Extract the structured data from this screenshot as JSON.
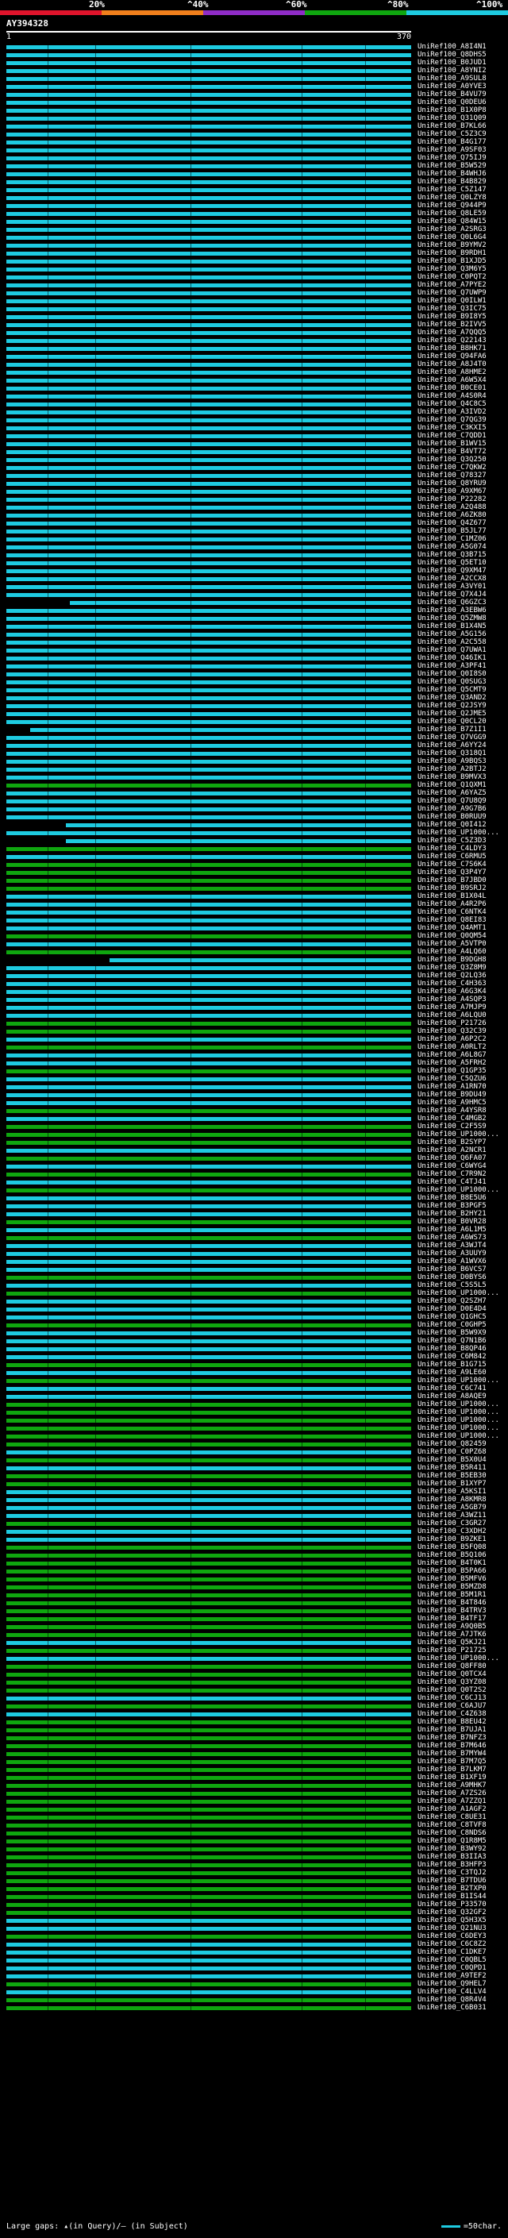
{
  "scale": {
    "labels": [
      "20%",
      "^40%",
      "^60%",
      "^80%",
      "^100%"
    ],
    "colors": [
      "#e0142c",
      "#f07f1c",
      "#8f2cc7",
      "#0fa60f",
      "#1ecbe1"
    ]
  },
  "query": {
    "id": "AY394328",
    "start": "1",
    "end": "370"
  },
  "hits": [
    {
      "label": "UniRef100_A8I4N1",
      "c": "#1ecbe1"
    },
    {
      "label": "UniRef100_Q8DHS5",
      "c": "#1ecbe1"
    },
    {
      "label": "UniRef100_B0JUD1",
      "c": "#1ecbe1"
    },
    {
      "label": "UniRef100_A8YNI2",
      "c": "#1ecbe1"
    },
    {
      "label": "UniRef100_A9SUL8",
      "c": "#1ecbe1"
    },
    {
      "label": "UniRef100_A0YVE3",
      "c": "#1ecbe1"
    },
    {
      "label": "UniRef100_B4VU79",
      "c": "#1ecbe1"
    },
    {
      "label": "UniRef100_Q0DEU6",
      "c": "#1ecbe1"
    },
    {
      "label": "UniRef100_B1X0P8",
      "c": "#1ecbe1"
    },
    {
      "label": "UniRef100_Q31Q09",
      "c": "#1ecbe1"
    },
    {
      "label": "UniRef100_B7KL66",
      "c": "#1ecbe1"
    },
    {
      "label": "UniRef100_C5Z3C9",
      "c": "#1ecbe1"
    },
    {
      "label": "UniRef100_B4G177",
      "c": "#1ecbe1"
    },
    {
      "label": "UniRef100_A9SF03",
      "c": "#1ecbe1"
    },
    {
      "label": "UniRef100_Q75IJ9",
      "c": "#1ecbe1"
    },
    {
      "label": "UniRef100_B5W529",
      "c": "#1ecbe1"
    },
    {
      "label": "UniRef100_B4WHJ6",
      "c": "#1ecbe1"
    },
    {
      "label": "UniRef100_B4B829",
      "c": "#1ecbe1"
    },
    {
      "label": "UniRef100_C5Z147",
      "c": "#1ecbe1"
    },
    {
      "label": "UniRef100_Q0LZY8",
      "c": "#1ecbe1"
    },
    {
      "label": "UniRef100_Q944P9",
      "c": "#1ecbe1"
    },
    {
      "label": "UniRef100_Q8LE59",
      "c": "#1ecbe1"
    },
    {
      "label": "UniRef100_Q84W15",
      "c": "#1ecbe1"
    },
    {
      "label": "UniRef100_A2SRG3",
      "c": "#1ecbe1"
    },
    {
      "label": "UniRef100_Q0L6G4",
      "c": "#1ecbe1"
    },
    {
      "label": "UniRef100_B9YMV2",
      "c": "#1ecbe1"
    },
    {
      "label": "UniRef100_B9RDH1",
      "c": "#1ecbe1"
    },
    {
      "label": "UniRef100_B1XJD5",
      "c": "#1ecbe1"
    },
    {
      "label": "UniRef100_Q3M6Y5",
      "c": "#1ecbe1"
    },
    {
      "label": "UniRef100_C0PQT2",
      "c": "#1ecbe1"
    },
    {
      "label": "UniRef100_A7PYE2",
      "c": "#1ecbe1"
    },
    {
      "label": "UniRef100_Q7UWP9",
      "c": "#1ecbe1"
    },
    {
      "label": "UniRef100_Q0ILW1",
      "c": "#1ecbe1"
    },
    {
      "label": "UniRef100_Q3IC75",
      "c": "#1ecbe1"
    },
    {
      "label": "UniRef100_B9I8Y5",
      "c": "#1ecbe1"
    },
    {
      "label": "UniRef100_B2IVV5",
      "c": "#1ecbe1"
    },
    {
      "label": "UniRef100_A7QQQ5",
      "c": "#1ecbe1"
    },
    {
      "label": "UniRef100_Q22143",
      "c": "#1ecbe1"
    },
    {
      "label": "UniRef100_B8HK71",
      "c": "#1ecbe1"
    },
    {
      "label": "UniRef100_Q94FA6",
      "c": "#1ecbe1"
    },
    {
      "label": "UniRef100_A8J4T0",
      "c": "#1ecbe1"
    },
    {
      "label": "UniRef100_A8HME2",
      "c": "#1ecbe1"
    },
    {
      "label": "UniRef100_A6W5X4",
      "c": "#1ecbe1"
    },
    {
      "label": "UniRef100_B0CE01",
      "c": "#1ecbe1"
    },
    {
      "label": "UniRef100_A4S0R4",
      "c": "#1ecbe1"
    },
    {
      "label": "UniRef100_Q4C8C5",
      "c": "#1ecbe1"
    },
    {
      "label": "UniRef100_A3IVD2",
      "c": "#1ecbe1"
    },
    {
      "label": "UniRef100_Q7QG39",
      "c": "#1ecbe1"
    },
    {
      "label": "UniRef100_C3KXI5",
      "c": "#1ecbe1"
    },
    {
      "label": "UniRef100_C7QDD1",
      "c": "#1ecbe1"
    },
    {
      "label": "UniRef100_B1WV15",
      "c": "#1ecbe1"
    },
    {
      "label": "UniRef100_B4VT72",
      "c": "#1ecbe1"
    },
    {
      "label": "UniRef100_Q3Q250",
      "c": "#1ecbe1"
    },
    {
      "label": "UniRef100_C7QKW2",
      "c": "#1ecbe1"
    },
    {
      "label": "UniRef100_Q78327",
      "c": "#1ecbe1"
    },
    {
      "label": "UniRef100_Q8YRU9",
      "c": "#1ecbe1"
    },
    {
      "label": "UniRef100_A9XM67",
      "c": "#1ecbe1"
    },
    {
      "label": "UniRef100_P22282",
      "c": "#1ecbe1"
    },
    {
      "label": "UniRef100_A2Q488",
      "c": "#1ecbe1"
    },
    {
      "label": "UniRef100_A6ZK80",
      "c": "#1ecbe1"
    },
    {
      "label": "UniRef100_Q4Z677",
      "c": "#1ecbe1"
    },
    {
      "label": "UniRef100_B5JL77",
      "c": "#1ecbe1"
    },
    {
      "label": "UniRef100_C1MZ06",
      "c": "#1ecbe1"
    },
    {
      "label": "UniRef100_A5G074",
      "c": "#1ecbe1"
    },
    {
      "label": "UniRef100_Q3B715",
      "c": "#1ecbe1"
    },
    {
      "label": "UniRef100_Q5ET10",
      "c": "#1ecbe1"
    },
    {
      "label": "UniRef100_Q9XM47",
      "c": "#1ecbe1"
    },
    {
      "label": "UniRef100_A2CCX8",
      "c": "#1ecbe1"
    },
    {
      "label": "UniRef100_A3VY01",
      "c": "#1ecbe1"
    },
    {
      "label": "UniRef100_Q7X4J4",
      "c": "#1ecbe1"
    },
    {
      "label": "UniRef100_Q6GZC3",
      "c": "#1ecbe1",
      "gapL": 0,
      "gapW": 0,
      "blackEnd": 80
    },
    {
      "label": "UniRef100_A3EBW6",
      "c": "#1ecbe1"
    },
    {
      "label": "UniRef100_Q5ZMW8",
      "c": "#1ecbe1"
    },
    {
      "label": "UniRef100_B1X4N5",
      "c": "#1ecbe1"
    },
    {
      "label": "UniRef100_A5G156",
      "c": "#1ecbe1"
    },
    {
      "label": "UniRef100_A2C558",
      "c": "#1ecbe1"
    },
    {
      "label": "UniRef100_Q7UWA1",
      "c": "#1ecbe1"
    },
    {
      "label": "UniRef100_Q46IK1",
      "c": "#1ecbe1"
    },
    {
      "label": "UniRef100_A3PF41",
      "c": "#1ecbe1"
    },
    {
      "label": "UniRef100_Q0I8S0",
      "c": "#1ecbe1"
    },
    {
      "label": "UniRef100_Q0SUG3",
      "c": "#1ecbe1"
    },
    {
      "label": "UniRef100_Q5CMT9",
      "c": "#1ecbe1"
    },
    {
      "label": "UniRef100_Q3AND2",
      "c": "#1ecbe1"
    },
    {
      "label": "UniRef100_Q2JSY9",
      "c": "#1ecbe1"
    },
    {
      "label": "UniRef100_Q2JME5",
      "c": "#1ecbe1"
    },
    {
      "label": "UniRef100_Q0CL20",
      "c": "#1ecbe1"
    },
    {
      "label": "UniRef100_B7Z1I1",
      "c": "#1ecbe1",
      "blackEnd": 30
    },
    {
      "label": "UniRef100_Q7VGG9",
      "c": "#1ecbe1"
    },
    {
      "label": "UniRef100_A6YY24",
      "c": "#1ecbe1"
    },
    {
      "label": "UniRef100_Q318Q1",
      "c": "#1ecbe1"
    },
    {
      "label": "UniRef100_A9BQS3",
      "c": "#1ecbe1"
    },
    {
      "label": "UniRef100_A2BTJ2",
      "c": "#1ecbe1"
    },
    {
      "label": "UniRef100_B9MVX3",
      "c": "#1ecbe1"
    },
    {
      "label": "UniRef100_Q1QXM1",
      "c": "#0fa60f"
    },
    {
      "label": "UniRef100_A6YAZ5",
      "c": "#1ecbe1"
    },
    {
      "label": "UniRef100_Q7U8Q9",
      "c": "#1ecbe1"
    },
    {
      "label": "UniRef100_A9G7B6",
      "c": "#1ecbe1"
    },
    {
      "label": "UniRef100_B0RUU9",
      "c": "#1ecbe1"
    },
    {
      "label": "UniRef100_Q0I412",
      "c": "#1ecbe1",
      "blackEnd": 75
    },
    {
      "label": "UniRef100_UP1000...",
      "c": "#1ecbe1"
    },
    {
      "label": "UniRef100_C5Z3D3",
      "c": "#1ecbe1",
      "blackEnd": 75
    },
    {
      "label": "UniRef100_C4LDY3",
      "c": "#0fa60f"
    },
    {
      "label": "UniRef100_C6RMU5",
      "c": "#1ecbe1"
    },
    {
      "label": "UniRef100_C7S6K4",
      "c": "#0fa60f"
    },
    {
      "label": "UniRef100_Q3P4Y7",
      "c": "#0fa60f"
    },
    {
      "label": "UniRef100_B7JBD0",
      "c": "#0fa60f"
    },
    {
      "label": "UniRef100_B9SRJ2",
      "c": "#0fa60f"
    },
    {
      "label": "UniRef100_B1X04L",
      "c": "#1ecbe1"
    },
    {
      "label": "UniRef100_A4R2P6",
      "c": "#1ecbe1"
    },
    {
      "label": "UniRef100_C6NTK4",
      "c": "#1ecbe1"
    },
    {
      "label": "UniRef100_Q8EI83",
      "c": "#1ecbe1"
    },
    {
      "label": "UniRef100_Q4AMT1",
      "c": "#1ecbe1"
    },
    {
      "label": "UniRef100_Q0QM54",
      "c": "#0fa60f"
    },
    {
      "label": "UniRef100_A5VTP0",
      "c": "#1ecbe1"
    },
    {
      "label": "UniRef100_A4LQ60",
      "c": "#0fa60f"
    },
    {
      "label": "UniRef100_B9DGH8",
      "c": "#1ecbe1",
      "blackEnd": 130
    },
    {
      "label": "UniRef100_Q3Z8M9",
      "c": "#1ecbe1"
    },
    {
      "label": "UniRef100_Q2LQ36",
      "c": "#1ecbe1"
    },
    {
      "label": "UniRef100_C4H363",
      "c": "#1ecbe1"
    },
    {
      "label": "UniRef100_A6G3K4",
      "c": "#1ecbe1"
    },
    {
      "label": "UniRef100_A4SQP3",
      "c": "#1ecbe1"
    },
    {
      "label": "UniRef100_A7MJP9",
      "c": "#1ecbe1"
    },
    {
      "label": "UniRef100_A6LQU0",
      "c": "#1ecbe1"
    },
    {
      "label": "UniRef100_P21726",
      "c": "#0fa60f"
    },
    {
      "label": "UniRef100_Q32C39",
      "c": "#0fa60f"
    },
    {
      "label": "UniRef100_A6P2C2",
      "c": "#1ecbe1"
    },
    {
      "label": "UniRef100_A0RLT2",
      "c": "#0fa60f"
    },
    {
      "label": "UniRef100_A6L8G7",
      "c": "#1ecbe1"
    },
    {
      "label": "UniRef100_A5FRH2",
      "c": "#1ecbe1"
    },
    {
      "label": "UniRef100_Q1GP35",
      "c": "#0fa60f"
    },
    {
      "label": "UniRef100_C5QZU6",
      "c": "#1ecbe1"
    },
    {
      "label": "UniRef100_A1RN70",
      "c": "#1ecbe1"
    },
    {
      "label": "UniRef100_B9DU49",
      "c": "#1ecbe1"
    },
    {
      "label": "UniRef100_A9HMC5",
      "c": "#1ecbe1"
    },
    {
      "label": "UniRef100_A4YSR8",
      "c": "#0fa60f"
    },
    {
      "label": "UniRef100_C4MGB2",
      "c": "#1ecbe1"
    },
    {
      "label": "UniRef100_C2F5S9",
      "c": "#0fa60f"
    },
    {
      "label": "UniRef100_UP1000...",
      "c": "#0fa60f"
    },
    {
      "label": "UniRef100_B2SYP7",
      "c": "#0fa60f"
    },
    {
      "label": "UniRef100_A2NCR1",
      "c": "#1ecbe1"
    },
    {
      "label": "UniRef100_Q6FA07",
      "c": "#0fa60f"
    },
    {
      "label": "UniRef100_C6WYG4",
      "c": "#1ecbe1"
    },
    {
      "label": "UniRef100_C7R9N2",
      "c": "#0fa60f"
    },
    {
      "label": "UniRef100_C4TJ41",
      "c": "#1ecbe1"
    },
    {
      "label": "UniRef100_UP1000...",
      "c": "#0fa60f"
    },
    {
      "label": "UniRef100_B8E5U6",
      "c": "#1ecbe1"
    },
    {
      "label": "UniRef100_B3PGF5",
      "c": "#1ecbe1"
    },
    {
      "label": "UniRef100_B2HY21",
      "c": "#1ecbe1"
    },
    {
      "label": "UniRef100_B0VR28",
      "c": "#0fa60f"
    },
    {
      "label": "UniRef100_A6L1M5",
      "c": "#1ecbe1"
    },
    {
      "label": "UniRef100_A6WS73",
      "c": "#0fa60f"
    },
    {
      "label": "UniRef100_A3WJT4",
      "c": "#1ecbe1"
    },
    {
      "label": "UniRef100_A3UUY9",
      "c": "#1ecbe1"
    },
    {
      "label": "UniRef100_A1WVX6",
      "c": "#1ecbe1"
    },
    {
      "label": "UniRef100_B6VCS7",
      "c": "#1ecbe1"
    },
    {
      "label": "UniRef100_D0BYS6",
      "c": "#0fa60f"
    },
    {
      "label": "UniRef100_C5S5L5",
      "c": "#1ecbe1"
    },
    {
      "label": "UniRef100_UP1000...",
      "c": "#0fa60f"
    },
    {
      "label": "UniRef100_Q2SZH7",
      "c": "#1ecbe1"
    },
    {
      "label": "UniRef100_D0E4D4",
      "c": "#1ecbe1"
    },
    {
      "label": "UniRef100_Q1GHC5",
      "c": "#1ecbe1"
    },
    {
      "label": "UniRef100_C0GHP5",
      "c": "#0fa60f"
    },
    {
      "label": "UniRef100_B5W9X9",
      "c": "#1ecbe1"
    },
    {
      "label": "UniRef100_Q7N1B6",
      "c": "#1ecbe1"
    },
    {
      "label": "UniRef100_B8QP46",
      "c": "#1ecbe1"
    },
    {
      "label": "UniRef100_C6M842",
      "c": "#1ecbe1"
    },
    {
      "label": "UniRef100_B1G715",
      "c": "#0fa60f"
    },
    {
      "label": "UniRef100_A9LE60",
      "c": "#1ecbe1"
    },
    {
      "label": "UniRef100_UP1000...",
      "c": "#0fa60f"
    },
    {
      "label": "UniRef100_C6C741",
      "c": "#1ecbe1"
    },
    {
      "label": "UniRef100_A8AQE9",
      "c": "#1ecbe1"
    },
    {
      "label": "UniRef100_UP1000...",
      "c": "#0fa60f"
    },
    {
      "label": "UniRef100_UP1000...",
      "c": "#0fa60f"
    },
    {
      "label": "UniRef100_UP1000...",
      "c": "#0fa60f"
    },
    {
      "label": "UniRef100_UP1000...",
      "c": "#0fa60f"
    },
    {
      "label": "UniRef100_UP1000...",
      "c": "#0fa60f"
    },
    {
      "label": "UniRef100_Q82459",
      "c": "#0fa60f"
    },
    {
      "label": "UniRef100_C0PZ68",
      "c": "#1ecbe1"
    },
    {
      "label": "UniRef100_B5X0U4",
      "c": "#0fa60f"
    },
    {
      "label": "UniRef100_B5R411",
      "c": "#1ecbe1"
    },
    {
      "label": "UniRef100_B5EB30",
      "c": "#0fa60f"
    },
    {
      "label": "UniRef100_B1XYP7",
      "c": "#0fa60f"
    },
    {
      "label": "UniRef100_A5KSI1",
      "c": "#1ecbe1"
    },
    {
      "label": "UniRef100_A8KMR8",
      "c": "#1ecbe1"
    },
    {
      "label": "UniRef100_A5GB79",
      "c": "#1ecbe1"
    },
    {
      "label": "UniRef100_A3WZ11",
      "c": "#1ecbe1"
    },
    {
      "label": "UniRef100_C3GR27",
      "c": "#0fa60f"
    },
    {
      "label": "UniRef100_C3XDH2",
      "c": "#1ecbe1"
    },
    {
      "label": "UniRef100_B9ZKE1",
      "c": "#1ecbe1"
    },
    {
      "label": "UniRef100_B5FQ08",
      "c": "#0fa60f"
    },
    {
      "label": "UniRef100_B5Q106",
      "c": "#0fa60f"
    },
    {
      "label": "UniRef100_B4T0K1",
      "c": "#0fa60f"
    },
    {
      "label": "UniRef100_B5PA66",
      "c": "#0fa60f"
    },
    {
      "label": "UniRef100_B5MFV6",
      "c": "#0fa60f"
    },
    {
      "label": "UniRef100_B5MZD8",
      "c": "#0fa60f"
    },
    {
      "label": "UniRef100_B5M1R1",
      "c": "#0fa60f"
    },
    {
      "label": "UniRef100_B4T846",
      "c": "#0fa60f"
    },
    {
      "label": "UniRef100_B4TRV3",
      "c": "#0fa60f"
    },
    {
      "label": "UniRef100_B4TF17",
      "c": "#0fa60f"
    },
    {
      "label": "UniRef100_A9Q0B5",
      "c": "#0fa60f"
    },
    {
      "label": "UniRef100_A7JTK6",
      "c": "#0fa60f"
    },
    {
      "label": "UniRef100_Q5KJ21",
      "c": "#1ecbe1"
    },
    {
      "label": "UniRef100_P21725",
      "c": "#0fa60f"
    },
    {
      "label": "UniRef100_UP1000...",
      "c": "#1ecbe1"
    },
    {
      "label": "UniRef100_Q8FF80",
      "c": "#0fa60f"
    },
    {
      "label": "UniRef100_Q0TCX4",
      "c": "#0fa60f"
    },
    {
      "label": "UniRef100_Q3YZ08",
      "c": "#0fa60f"
    },
    {
      "label": "UniRef100_Q0T2S2",
      "c": "#0fa60f"
    },
    {
      "label": "UniRef100_C6CJ13",
      "c": "#1ecbe1"
    },
    {
      "label": "UniRef100_C6AJU7",
      "c": "#0fa60f"
    },
    {
      "label": "UniRef100_C4Z638",
      "c": "#1ecbe1"
    },
    {
      "label": "UniRef100_B8EU42",
      "c": "#0fa60f"
    },
    {
      "label": "UniRef100_B7UJA1",
      "c": "#0fa60f"
    },
    {
      "label": "UniRef100_B7NFZ3",
      "c": "#0fa60f"
    },
    {
      "label": "UniRef100_B7M646",
      "c": "#0fa60f"
    },
    {
      "label": "UniRef100_B7MYW4",
      "c": "#0fa60f"
    },
    {
      "label": "UniRef100_B7M7Q5",
      "c": "#0fa60f"
    },
    {
      "label": "UniRef100_B7LKM7",
      "c": "#0fa60f"
    },
    {
      "label": "UniRef100_B1XF19",
      "c": "#0fa60f"
    },
    {
      "label": "UniRef100_A9MHK7",
      "c": "#0fa60f"
    },
    {
      "label": "UniRef100_A7ZS26",
      "c": "#0fa60f"
    },
    {
      "label": "UniRef100_A7ZZQ1",
      "c": "#0fa60f"
    },
    {
      "label": "UniRef100_A1AGF2",
      "c": "#0fa60f"
    },
    {
      "label": "UniRef100_C8UE31",
      "c": "#0fa60f"
    },
    {
      "label": "UniRef100_C8TVF8",
      "c": "#0fa60f"
    },
    {
      "label": "UniRef100_C8NDS6",
      "c": "#0fa60f"
    },
    {
      "label": "UniRef100_Q1R8M5",
      "c": "#0fa60f"
    },
    {
      "label": "UniRef100_B3WY92",
      "c": "#0fa60f"
    },
    {
      "label": "UniRef100_B3IIA3",
      "c": "#0fa60f"
    },
    {
      "label": "UniRef100_B3HFP3",
      "c": "#0fa60f"
    },
    {
      "label": "UniRef100_C3TQJ2",
      "c": "#0fa60f"
    },
    {
      "label": "UniRef100_B7TDU6",
      "c": "#0fa60f"
    },
    {
      "label": "UniRef100_B2TXP0",
      "c": "#0fa60f"
    },
    {
      "label": "UniRef100_B1IS44",
      "c": "#0fa60f"
    },
    {
      "label": "UniRef100_P33570",
      "c": "#0fa60f"
    },
    {
      "label": "UniRef100_Q32GF2",
      "c": "#0fa60f"
    },
    {
      "label": "UniRef100_Q5H3X5",
      "c": "#1ecbe1"
    },
    {
      "label": "UniRef100_Q21NU3",
      "c": "#1ecbe1"
    },
    {
      "label": "UniRef100_C6DEY3",
      "c": "#0fa60f"
    },
    {
      "label": "UniRef100_C6C8Z2",
      "c": "#1ecbe1"
    },
    {
      "label": "UniRef100_C1DKE7",
      "c": "#1ecbe1"
    },
    {
      "label": "UniRef100_C0QBL5",
      "c": "#1ecbe1"
    },
    {
      "label": "UniRef100_C0QPD1",
      "c": "#1ecbe1"
    },
    {
      "label": "UniRef100_A9TEF2",
      "c": "#1ecbe1"
    },
    {
      "label": "UniRef100_Q9HEL7",
      "c": "#0fa60f"
    },
    {
      "label": "UniRef100_C4LLV4",
      "c": "#1ecbe1"
    },
    {
      "label": "UniRef100_Q8R4V4",
      "c": "#0fa60f"
    },
    {
      "label": "UniRef100_C6B031",
      "c": "#0fa60f"
    }
  ],
  "legend": {
    "left": "Large gaps: ▴(in Query)/– (in Subject)",
    "right": "=50char."
  }
}
